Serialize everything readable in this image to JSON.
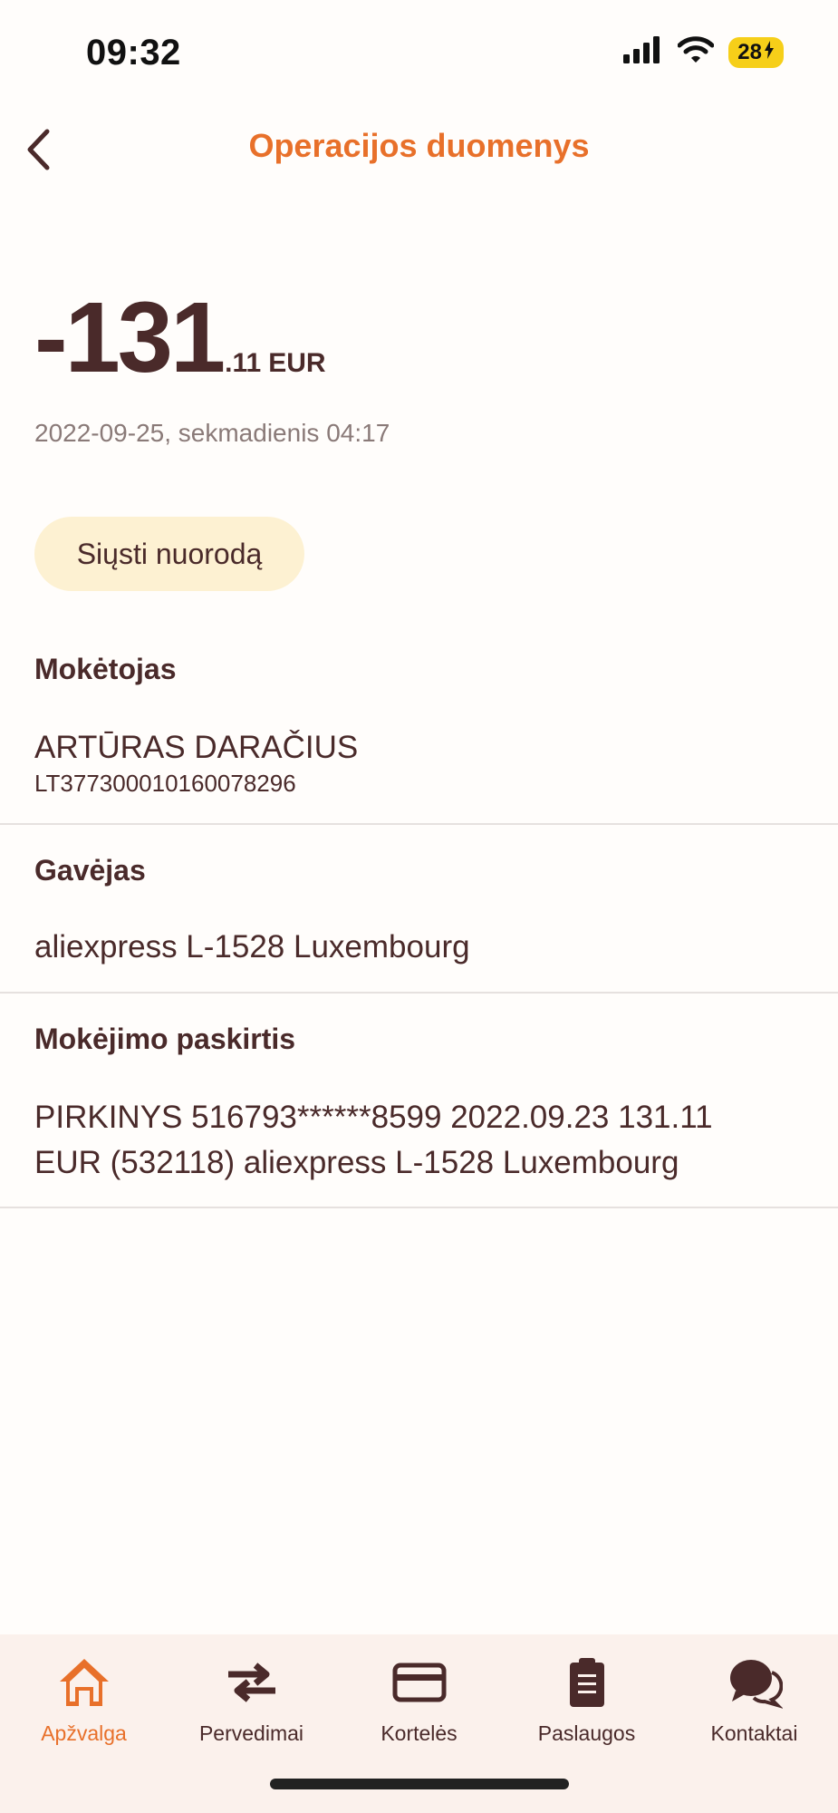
{
  "status": {
    "time": "09:32",
    "battery": "28"
  },
  "header": {
    "title": "Operacijos duomenys"
  },
  "amount": {
    "integer": "-131",
    "decimal": ".11",
    "currency": "EUR"
  },
  "date": "2022-09-25, sekmadienis 04:17",
  "share_button": "Siųsti nuorodą",
  "payer": {
    "label": "Mokėtojas",
    "name": "ARTŪRAS DARAČIUS",
    "iban": "LT377300010160078296"
  },
  "recipient": {
    "label": "Gavėjas",
    "name": "aliexpress L-1528 Luxembourg"
  },
  "purpose": {
    "label": "Mokėjimo paskirtis",
    "line1": "PIRKINYS 516793******8599 2022.09.23 131.11",
    "line2": "EUR (532118) aliexpress L-1528 Luxembourg"
  },
  "nav": [
    {
      "label": "Apžvalga",
      "icon": "home-icon",
      "active": true
    },
    {
      "label": "Pervedimai",
      "icon": "transfer-icon",
      "active": false
    },
    {
      "label": "Kortelės",
      "icon": "card-icon",
      "active": false
    },
    {
      "label": "Paslaugos",
      "icon": "clipboard-icon",
      "active": false
    },
    {
      "label": "Kontaktai",
      "icon": "chat-icon",
      "active": false
    }
  ],
  "colors": {
    "accent": "#e8702a",
    "text": "#4a2a2a",
    "button_bg": "#fdf1d2",
    "nav_bg": "#fbf1ec"
  }
}
